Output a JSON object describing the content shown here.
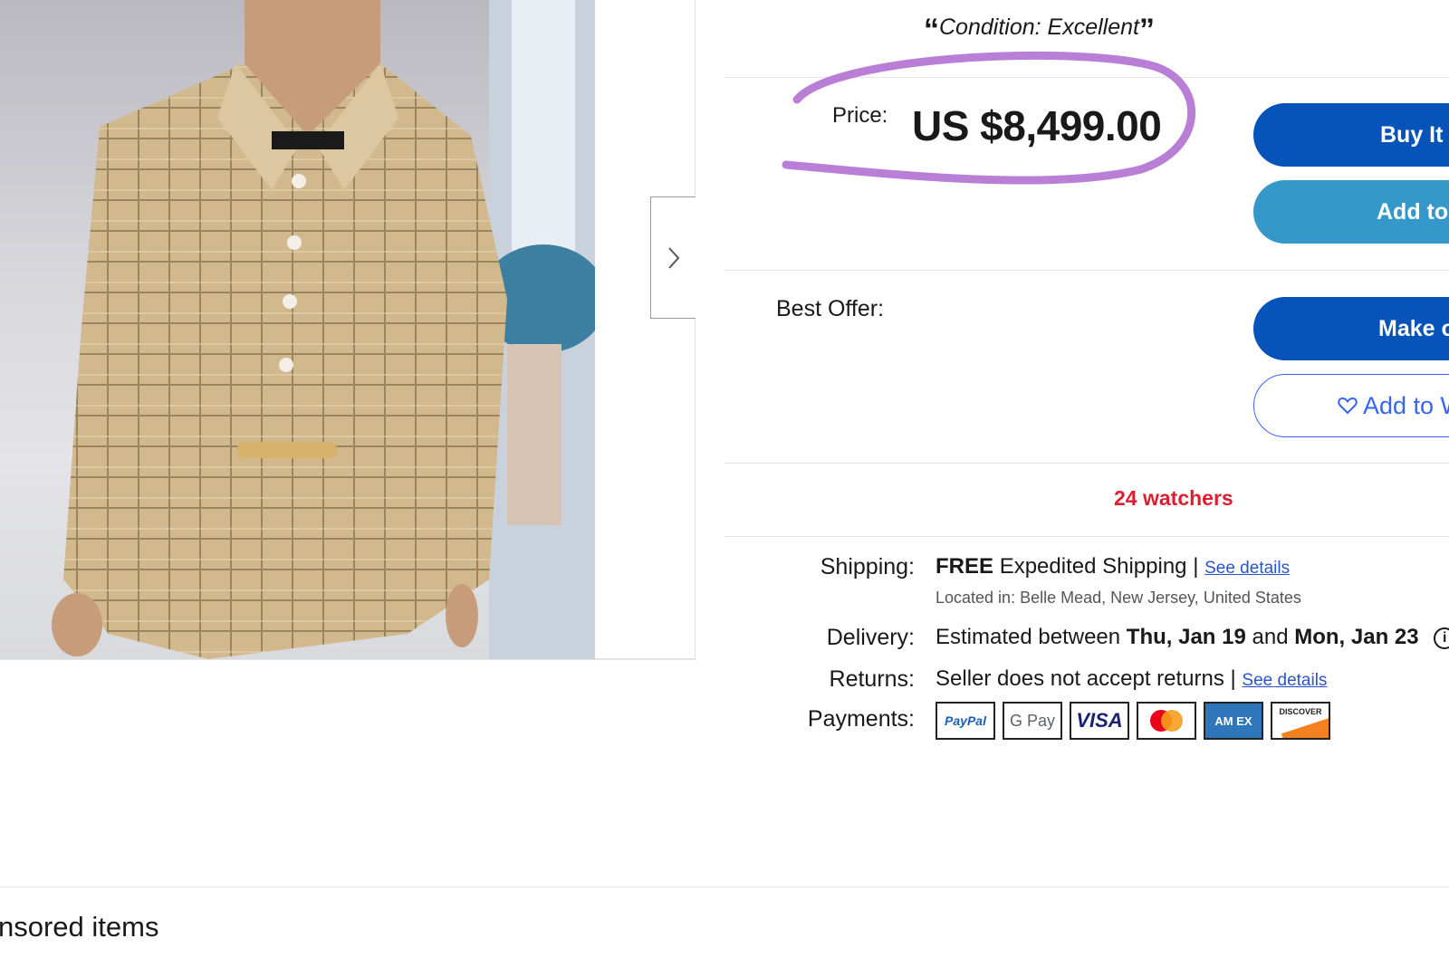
{
  "condition": {
    "text": "Condition: Excellent",
    "open_quote": "“",
    "close_quote": "”"
  },
  "price": {
    "label": "Price:",
    "value": "US $8,499.00"
  },
  "buttons": {
    "buy_it_now": "Buy It",
    "add_to_cart": "Add to",
    "make_offer": "Make o",
    "add_to_watchlist": "Add to W"
  },
  "best_offer": {
    "label": "Best Offer:"
  },
  "watchers": "24 watchers",
  "shipping": {
    "label": "Shipping:",
    "free": "FREE",
    "text": "Expedited Shipping",
    "separator": "|",
    "link": "See details",
    "located": "Located in: Belle Mead, New Jersey, United States"
  },
  "delivery": {
    "label": "Delivery:",
    "prefix": "Estimated between",
    "start": "Thu, Jan 19",
    "and": "and",
    "end": "Mon, Jan 23",
    "info": "i"
  },
  "returns": {
    "label": "Returns:",
    "text": "Seller does not accept returns",
    "separator": "|",
    "link": "See details"
  },
  "payments": {
    "label": "Payments:",
    "methods": [
      "PayPal",
      "G Pay",
      "VISA",
      "",
      "AM EX",
      "DISCOVER"
    ]
  },
  "sponsored": "nsored items",
  "colors": {
    "primary_blue": "#0654ba",
    "light_blue": "#3498ca",
    "watchers_red": "#dd1e31",
    "circle_purple": "#b97fd6"
  }
}
